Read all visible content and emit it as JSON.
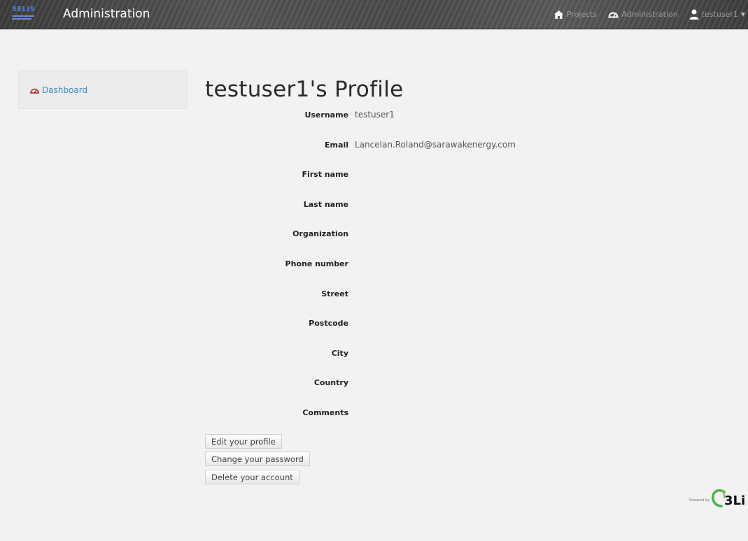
{
  "navbar": {
    "logo_text": "SELIS",
    "title": "Administration",
    "items": [
      {
        "label": "Projects",
        "icon": "home-icon"
      },
      {
        "label": "Administration",
        "icon": "dashboard-gauge-icon"
      },
      {
        "label": "testuser1",
        "icon": "user-icon"
      }
    ]
  },
  "sidebar": {
    "items": [
      {
        "label": "Dashboard",
        "icon": "dashboard-gauge-icon"
      }
    ]
  },
  "profile": {
    "title": "testuser1's Profile",
    "fields": [
      {
        "label": "Username",
        "value": "testuser1"
      },
      {
        "label": "Email",
        "value": "Lancelan.Roland@sarawakenergy.com"
      },
      {
        "label": "First name",
        "value": ""
      },
      {
        "label": "Last name",
        "value": ""
      },
      {
        "label": "Organization",
        "value": ""
      },
      {
        "label": "Phone number",
        "value": ""
      },
      {
        "label": "Street",
        "value": ""
      },
      {
        "label": "Postcode",
        "value": ""
      },
      {
        "label": "City",
        "value": ""
      },
      {
        "label": "Country",
        "value": ""
      },
      {
        "label": "Comments",
        "value": ""
      }
    ]
  },
  "actions": {
    "edit_label": "Edit your profile",
    "password_label": "Change your password",
    "delete_label": "Delete your account"
  },
  "footer": {
    "powered_by": "Powered by",
    "brand": "3Li"
  },
  "colors": {
    "link": "#3b8bc4",
    "navbar": "#4a4a4a",
    "background": "#f2f2f2"
  }
}
